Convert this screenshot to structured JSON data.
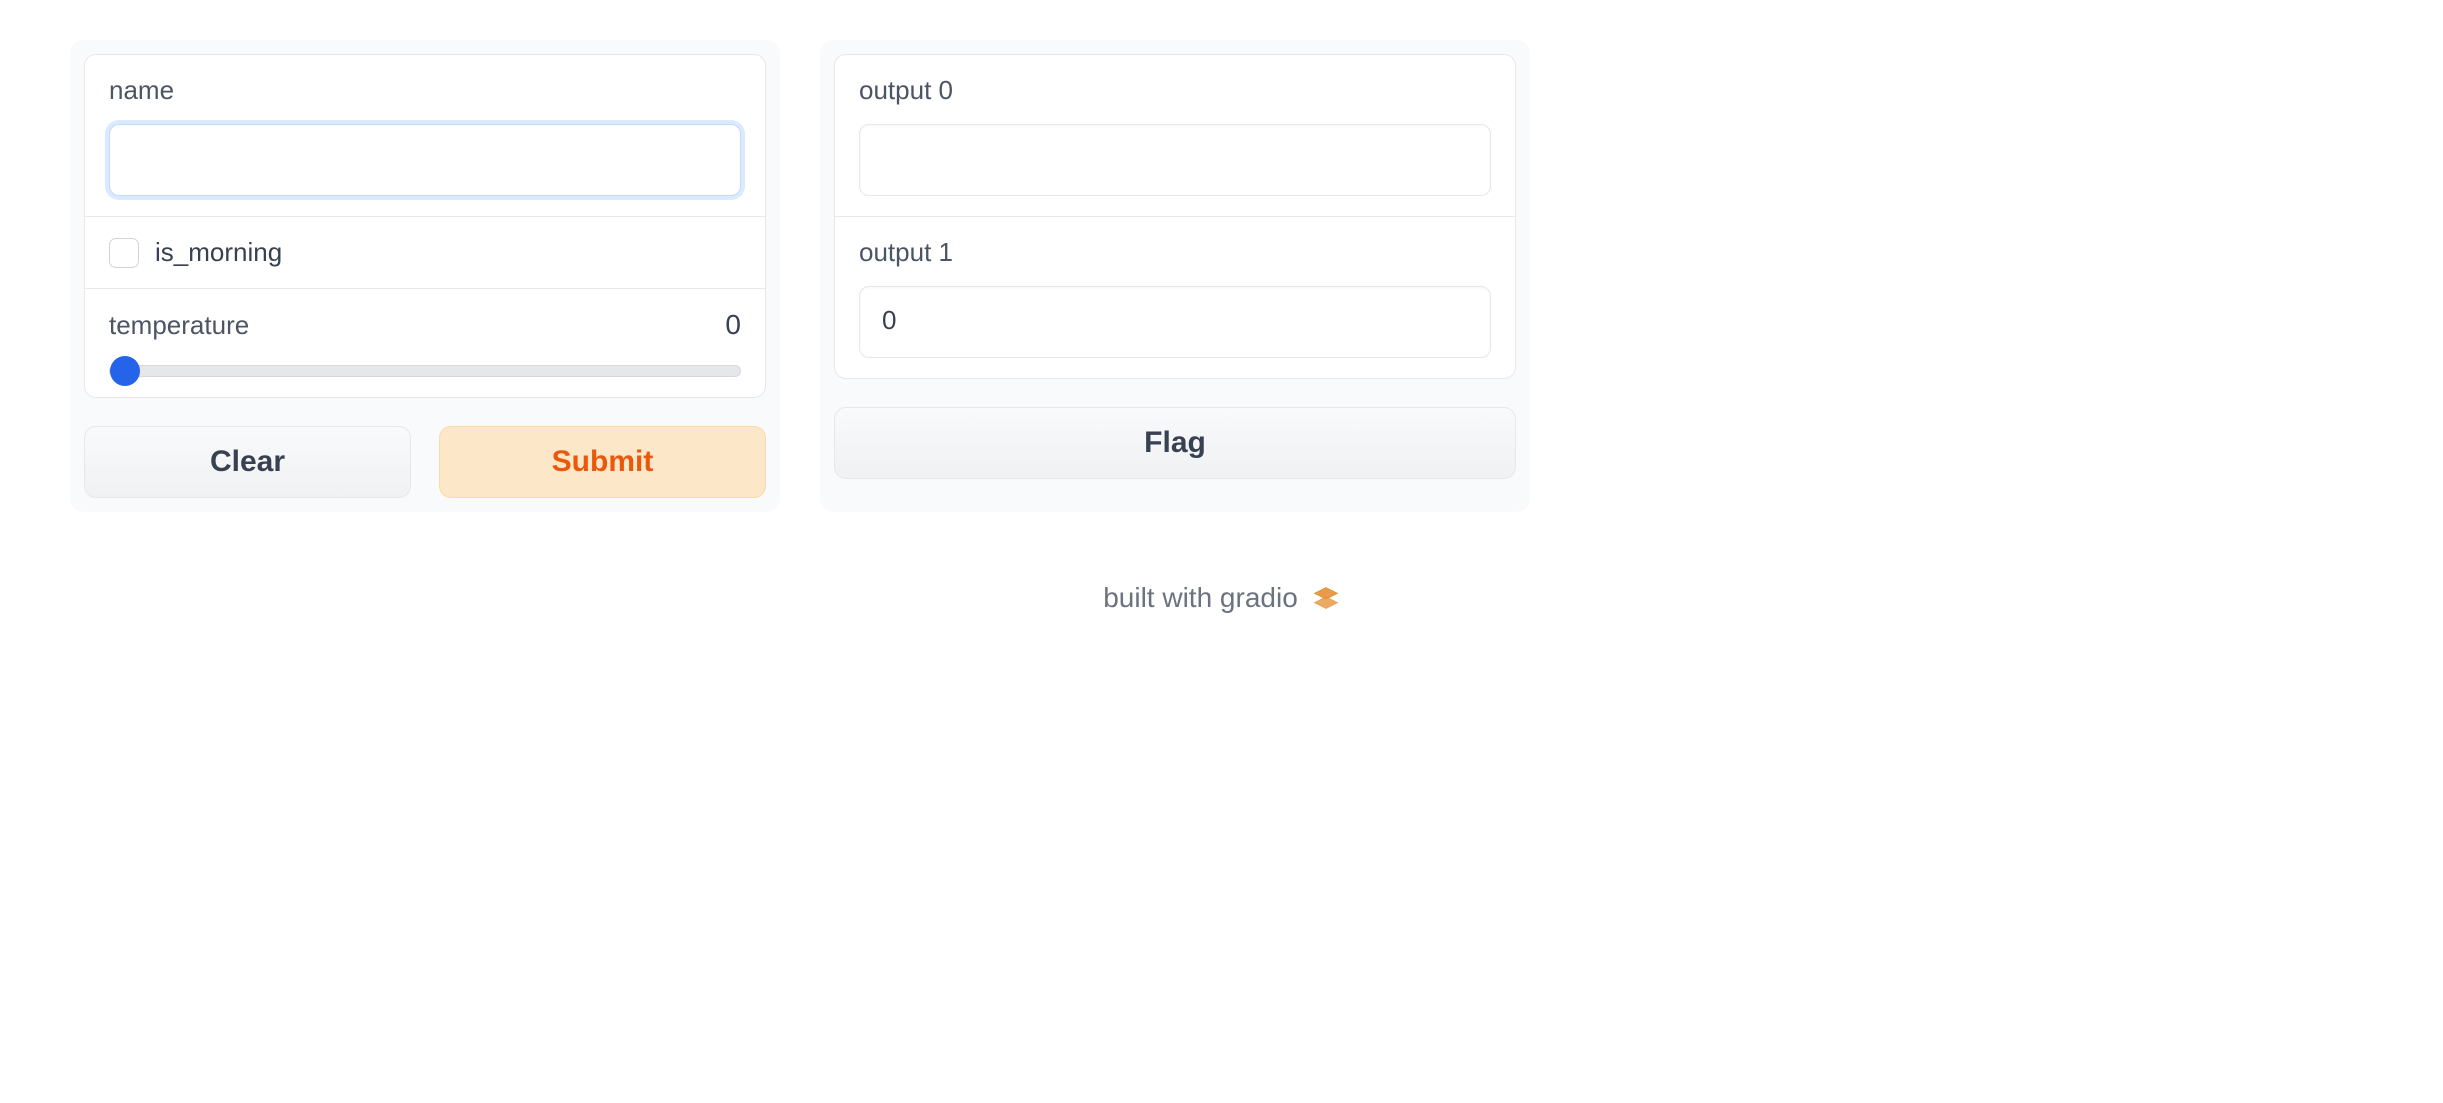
{
  "inputs": {
    "name": {
      "label": "name",
      "value": ""
    },
    "is_morning": {
      "label": "is_morning",
      "checked": false
    },
    "temperature": {
      "label": "temperature",
      "value": "0"
    }
  },
  "outputs": {
    "output0": {
      "label": "output 0",
      "value": ""
    },
    "output1": {
      "label": "output 1",
      "value": "0"
    }
  },
  "buttons": {
    "clear": "Clear",
    "submit": "Submit",
    "flag": "Flag"
  },
  "footer": {
    "text": "built with gradio"
  }
}
